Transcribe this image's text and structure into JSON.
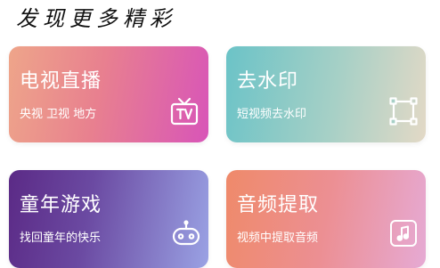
{
  "section": {
    "title": "发现更多精彩"
  },
  "cards": [
    {
      "title": "电视直播",
      "subtitle": "央视 卫视 地方",
      "icon": "tv-icon"
    },
    {
      "title": "去水印",
      "subtitle": "短视频去水印",
      "icon": "crop-frame-icon"
    },
    {
      "title": "童年游戏",
      "subtitle": "找回童年的快乐",
      "icon": "gamepad-icon"
    },
    {
      "title": "音频提取",
      "subtitle": "视频中提取音频",
      "icon": "music-note-icon"
    }
  ],
  "colors": {
    "live_tv_gradient": [
      "#eea58a",
      "#e8808f",
      "#d855b8"
    ],
    "watermark_gradient": [
      "#6bc3c7",
      "#a7d0c6",
      "#e3d9c6"
    ],
    "games_gradient": [
      "#5b2a86",
      "#6b4aa2",
      "#9aa2e4"
    ],
    "audio_gradient": [
      "#ef8a6a",
      "#ec8f93",
      "#e6aad4"
    ]
  }
}
